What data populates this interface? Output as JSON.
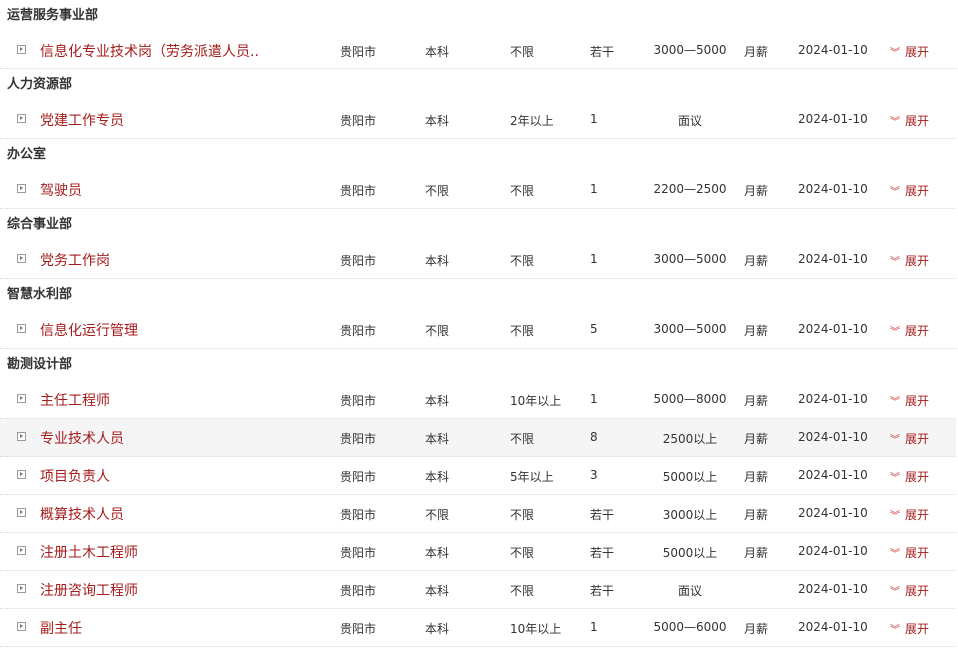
{
  "expand_label": "展开",
  "accent_color": "#a61c1c",
  "sections": [
    {
      "department": "运营服务事业部",
      "jobs": [
        {
          "title": "信息化专业技术岗（劳务派遣人员..",
          "city": "贵阳市",
          "education": "本科",
          "experience": "不限",
          "count": "若干",
          "salary": "3000—5000",
          "period": "月薪",
          "date": "2024-01-10"
        }
      ]
    },
    {
      "department": "人力资源部",
      "jobs": [
        {
          "title": "党建工作专员",
          "city": "贵阳市",
          "education": "本科",
          "experience": "2年以上",
          "count": "1",
          "salary": "面议",
          "period": "",
          "date": "2024-01-10"
        }
      ]
    },
    {
      "department": "办公室",
      "jobs": [
        {
          "title": "驾驶员",
          "city": "贵阳市",
          "education": "不限",
          "experience": "不限",
          "count": "1",
          "salary": "2200—2500",
          "period": "月薪",
          "date": "2024-01-10"
        }
      ]
    },
    {
      "department": "综合事业部",
      "jobs": [
        {
          "title": "党务工作岗",
          "city": "贵阳市",
          "education": "本科",
          "experience": "不限",
          "count": "1",
          "salary": "3000—5000",
          "period": "月薪",
          "date": "2024-01-10"
        }
      ]
    },
    {
      "department": "智慧水利部",
      "jobs": [
        {
          "title": "信息化运行管理",
          "city": "贵阳市",
          "education": "不限",
          "experience": "不限",
          "count": "5",
          "salary": "3000—5000",
          "period": "月薪",
          "date": "2024-01-10"
        }
      ]
    },
    {
      "department": "勘测设计部",
      "jobs": [
        {
          "title": "主任工程师",
          "city": "贵阳市",
          "education": "本科",
          "experience": "10年以上",
          "count": "1",
          "salary": "5000—8000",
          "period": "月薪",
          "date": "2024-01-10"
        },
        {
          "title": "专业技术人员",
          "city": "贵阳市",
          "education": "本科",
          "experience": "不限",
          "count": "8",
          "salary": "2500以上",
          "period": "月薪",
          "date": "2024-01-10"
        },
        {
          "title": "项目负责人",
          "city": "贵阳市",
          "education": "本科",
          "experience": "5年以上",
          "count": "3",
          "salary": "5000以上",
          "period": "月薪",
          "date": "2024-01-10"
        },
        {
          "title": "概算技术人员",
          "city": "贵阳市",
          "education": "不限",
          "experience": "不限",
          "count": "若干",
          "salary": "3000以上",
          "period": "月薪",
          "date": "2024-01-10"
        },
        {
          "title": "注册土木工程师",
          "city": "贵阳市",
          "education": "本科",
          "experience": "不限",
          "count": "若干",
          "salary": "5000以上",
          "period": "月薪",
          "date": "2024-01-10"
        },
        {
          "title": "注册咨询工程师",
          "city": "贵阳市",
          "education": "本科",
          "experience": "不限",
          "count": "若干",
          "salary": "面议",
          "period": "",
          "date": "2024-01-10"
        },
        {
          "title": "副主任",
          "city": "贵阳市",
          "education": "本科",
          "experience": "10年以上",
          "count": "1",
          "salary": "5000—6000",
          "period": "月薪",
          "date": "2024-01-10"
        }
      ]
    }
  ]
}
